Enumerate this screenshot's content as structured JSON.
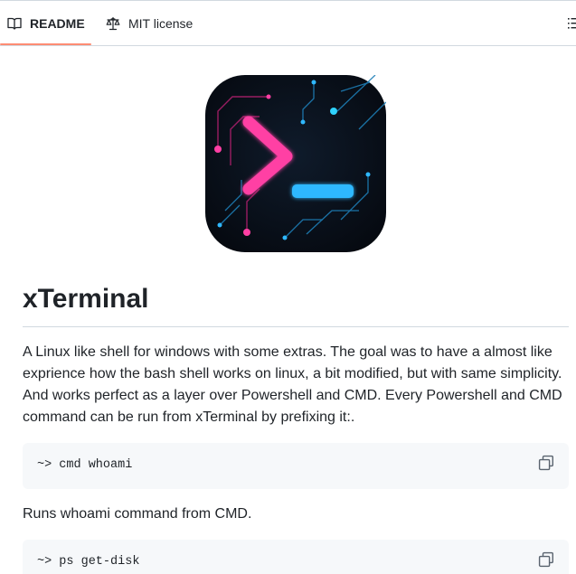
{
  "tabs": {
    "readme": "README",
    "license": "MIT license"
  },
  "readme": {
    "title": "xTerminal",
    "intro": "A Linux like shell for windows with some extras. The goal was to have a almost like exprience how the bash shell works on linux, a bit modified, but with same simplicity. And works perfect as a layer over Powershell and CMD. Every Powershell and CMD command can be run from xTerminal by prefixing it:.",
    "code_blocks": [
      {
        "code": "~> cmd whoami"
      },
      {
        "code": "~> ps get-disk"
      }
    ],
    "after_first_code": "Runs whoami command from CMD."
  },
  "icons": {
    "readme_tab": "book-icon",
    "license_tab": "law-scale-icon",
    "outline": "list-outline-icon",
    "copy": "copy-icon"
  },
  "colors": {
    "tab_underline": "#fd8c73",
    "code_bg": "#f6f8fa",
    "logo_pink": "#ff3fa4",
    "logo_cyan": "#2fb8ff"
  }
}
